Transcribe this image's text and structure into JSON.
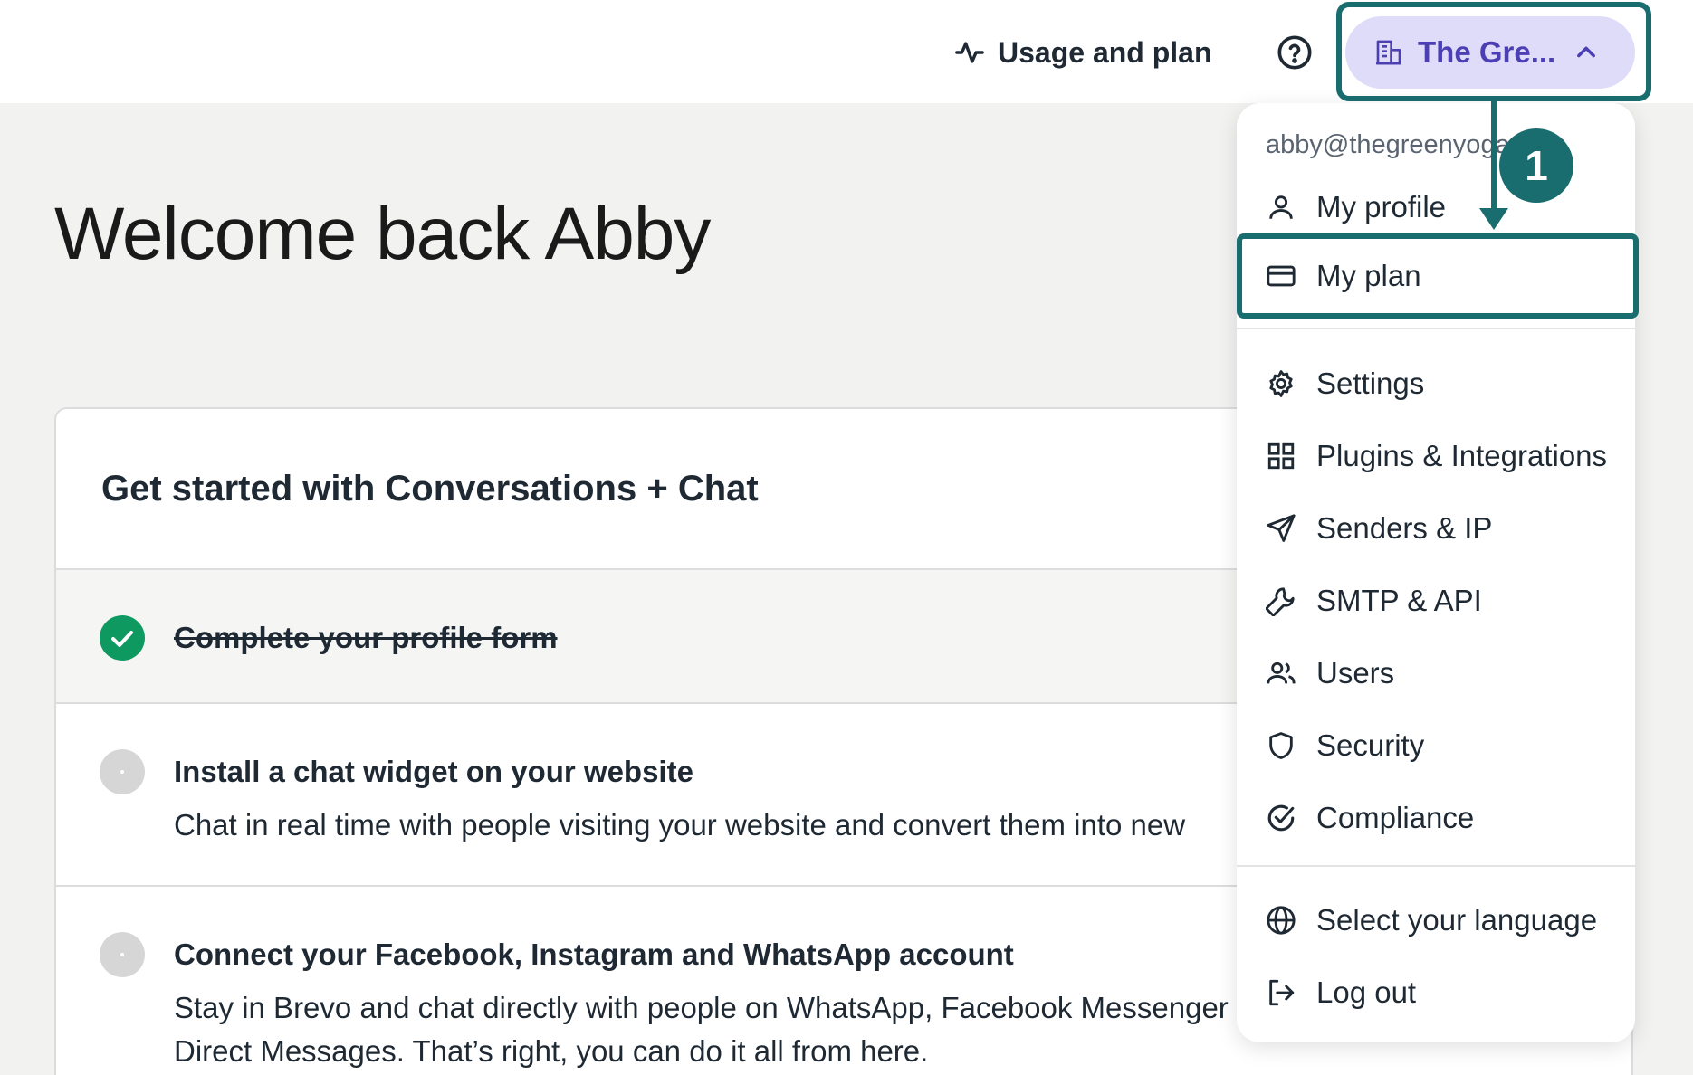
{
  "header": {
    "usage_label": "Usage and plan",
    "account_label": "The Gre..."
  },
  "welcome": {
    "title": "Welcome back Abby"
  },
  "card": {
    "title": "Get started with Conversations + Chat",
    "tasks": [
      {
        "title": "Complete your profile form",
        "description": "",
        "done": true
      },
      {
        "title": "Install a chat widget on your website",
        "description": "Chat in real time with people visiting your website and convert them into new",
        "done": false
      },
      {
        "title": "Connect your Facebook, Instagram and WhatsApp account",
        "description": "Stay in Brevo and chat directly with people on WhatsApp, Facebook Messenger Direct Messages. That’s right, you can do it all from here.",
        "done": false
      }
    ]
  },
  "menu": {
    "email": "abby@thegreenyoga.com",
    "items": [
      {
        "label": "My profile",
        "icon": "user-icon"
      },
      {
        "label": "My plan",
        "icon": "credit-card-icon"
      },
      {
        "label": "Settings",
        "icon": "gear-icon"
      },
      {
        "label": "Plugins & Integrations",
        "icon": "grid-icon"
      },
      {
        "label": "Senders & IP",
        "icon": "send-icon"
      },
      {
        "label": "SMTP & API",
        "icon": "wrench-icon"
      },
      {
        "label": "Users",
        "icon": "users-icon"
      },
      {
        "label": "Security",
        "icon": "shield-icon"
      },
      {
        "label": "Compliance",
        "icon": "check-circle-icon"
      },
      {
        "label": "Select your language",
        "icon": "globe-icon"
      },
      {
        "label": "Log out",
        "icon": "logout-icon"
      }
    ]
  },
  "annotation": {
    "step": "1"
  },
  "colors": {
    "accent": "#4b3fb3",
    "account_bg": "#dedcf8",
    "highlight": "#1a6d6f",
    "success": "#0e9960"
  }
}
